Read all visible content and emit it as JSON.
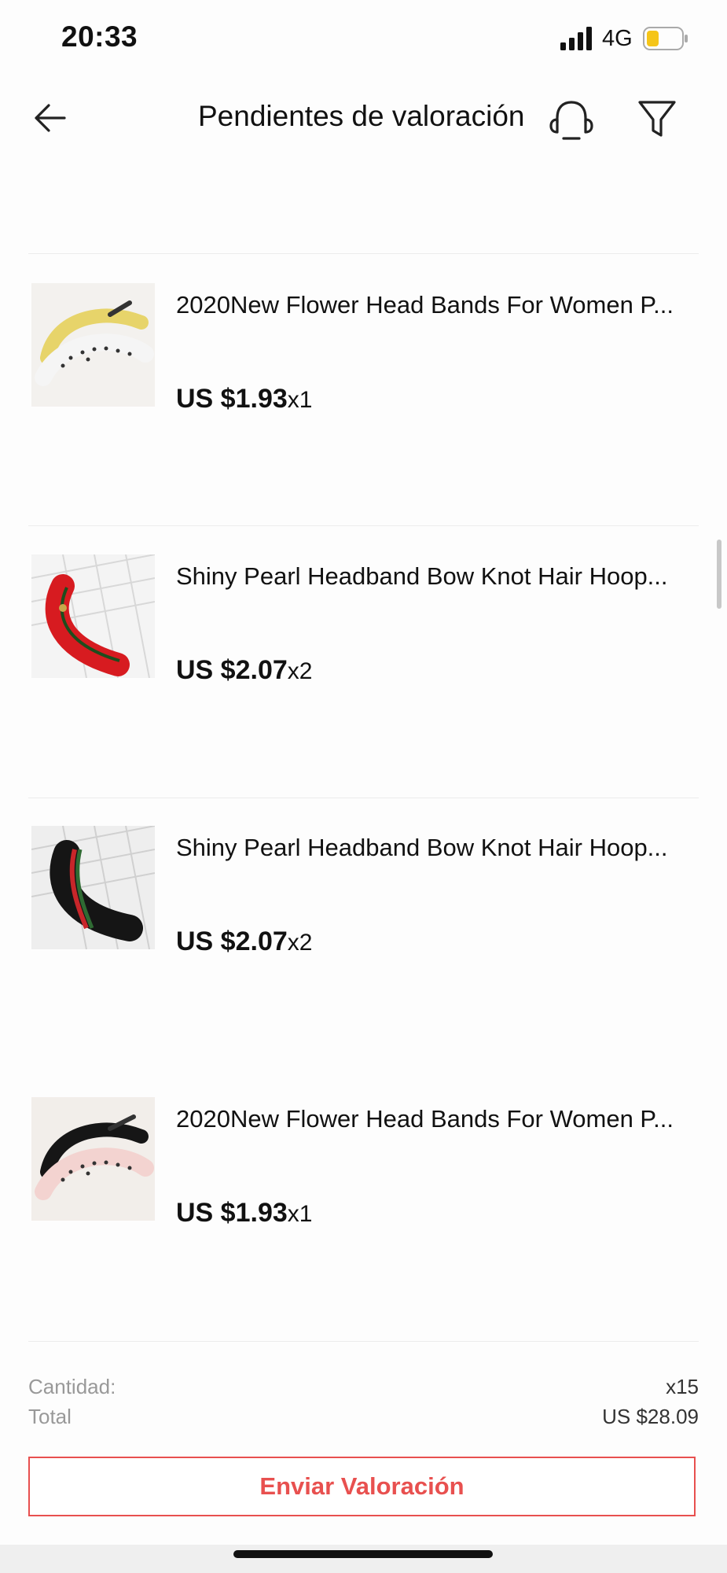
{
  "status_bar": {
    "time": "20:33",
    "network": "4G",
    "battery_color": "#f5c518"
  },
  "header": {
    "title": "Pendientes de valoración"
  },
  "items": [
    {
      "title": "2020New Flower Head Bands For Women P...",
      "price": "US $1.93",
      "qty": "x1",
      "image": "yellow-polka-dot-headband"
    },
    {
      "title": "Shiny Pearl Headband Bow Knot Hair Hoop...",
      "price": "US $2.07",
      "qty": "x2",
      "image": "red-knot-headband"
    },
    {
      "title": "Shiny Pearl Headband Bow Knot Hair Hoop...",
      "price": "US $2.07",
      "qty": "x2",
      "image": "black-knot-headband"
    },
    {
      "title": "2020New Flower Head Bands For Women P...",
      "price": "US $1.93",
      "qty": "x1",
      "image": "pink-polka-dot-headband"
    }
  ],
  "summary": {
    "quantity_label": "Cantidad:",
    "quantity_value": "x15",
    "total_label": "Total",
    "total_value": "US $28.09"
  },
  "submit_label": "Enviar Valoración",
  "colors": {
    "accent": "#e8504f",
    "divider": "#ececec"
  }
}
